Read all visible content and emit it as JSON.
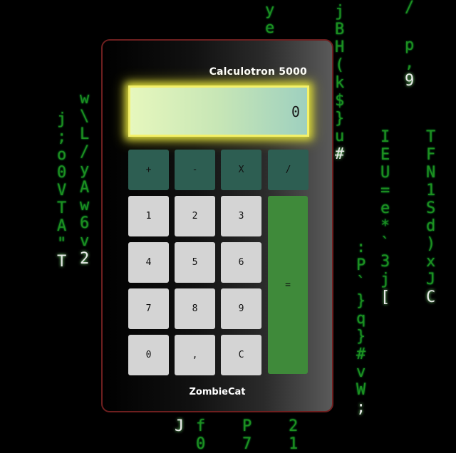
{
  "calculator": {
    "title": "Calculotron 5000",
    "display_value": "0",
    "footer": "ZombieCat",
    "keys": {
      "add": "+",
      "subtract": "-",
      "multiply": "X",
      "divide": "/",
      "one": "1",
      "two": "2",
      "three": "3",
      "four": "4",
      "five": "5",
      "six": "6",
      "seven": "7",
      "eight": "8",
      "nine": "9",
      "zero": "0",
      "comma": ",",
      "clear": "C",
      "equals": "="
    }
  },
  "background": {
    "columns": [
      {
        "chars": [
          "y",
          "e"
        ]
      },
      {
        "chars": [
          "j",
          "B",
          "H",
          "(",
          "k",
          "$",
          "}",
          "u",
          "#"
        ]
      },
      {
        "chars": [
          "/",
          "p",
          ",",
          "9"
        ]
      },
      {
        "chars": [
          "w",
          "\\",
          "L",
          "/",
          "y",
          "A",
          "w",
          "6",
          "v",
          "2"
        ]
      },
      {
        "chars": [
          "j",
          ";",
          "o",
          "0",
          "V",
          "T",
          "A",
          "\"",
          "T"
        ]
      },
      {
        "chars": [
          "I",
          "E",
          "U",
          "=",
          "e",
          "*",
          "`",
          "3",
          "j",
          "["
        ]
      },
      {
        "chars": [
          "T",
          "F",
          "N",
          "1",
          "S",
          "d",
          ")",
          "x",
          "J",
          "C"
        ]
      },
      {
        "chars": [
          ":",
          "P",
          "`",
          "}",
          "q",
          "}",
          "#",
          "v",
          "W",
          ";"
        ]
      },
      {
        "chars": [
          "J",
          "f",
          "0"
        ]
      },
      {
        "chars": [
          "P",
          "7"
        ]
      },
      {
        "chars": [
          "2",
          "1"
        ]
      }
    ],
    "colors": {
      "green": "#1f8f1f",
      "head": "#e8e8e8",
      "equals_key": "#3f8a3a",
      "operator_key": "#2d5e52"
    }
  }
}
